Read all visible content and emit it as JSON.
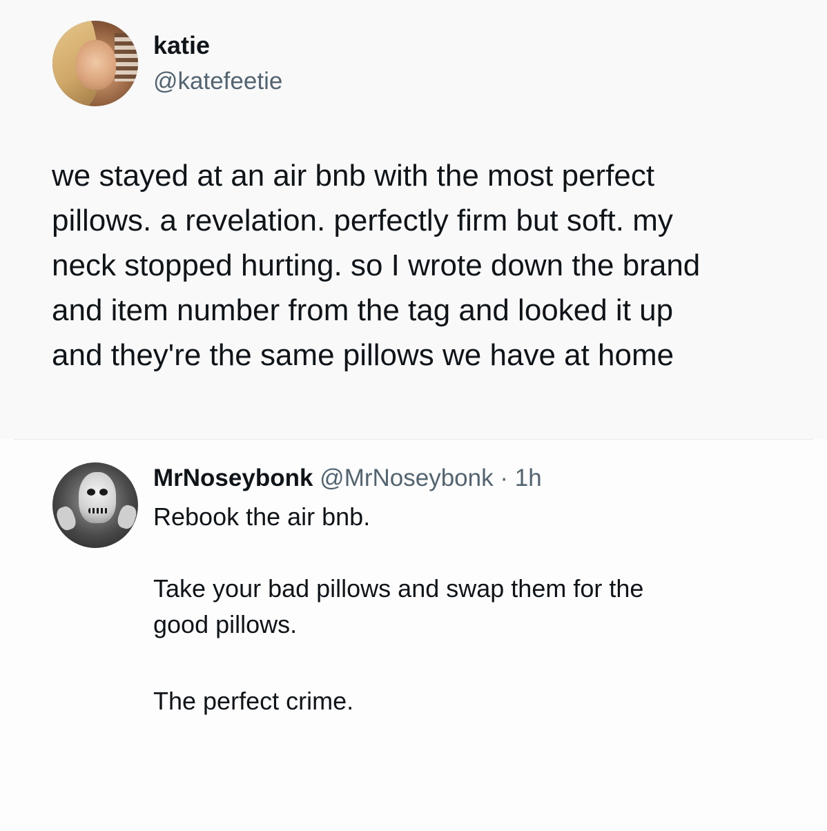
{
  "original_tweet": {
    "display_name": "katie",
    "handle": "@katefeetie",
    "text_lines": [
      "we stayed at an air bnb with the most perfect",
      "pillows. a revelation. perfectly firm but soft. my",
      "neck stopped hurting. so I wrote down the brand",
      "and item number from the tag and looked it up",
      "and they're the same pillows we have at home"
    ]
  },
  "reply": {
    "display_name": "MrNoseybonk",
    "handle": "@MrNoseybonk",
    "separator": "·",
    "time": "1h",
    "paragraph_1": "Rebook the air bnb.",
    "paragraph_2_lines": [
      "Take your bad pillows and swap them for the",
      "good pillows."
    ],
    "paragraph_3": "The perfect crime."
  },
  "colors": {
    "text_primary": "#0f1419",
    "text_secondary": "#536471",
    "divider": "#e6e8ea"
  }
}
